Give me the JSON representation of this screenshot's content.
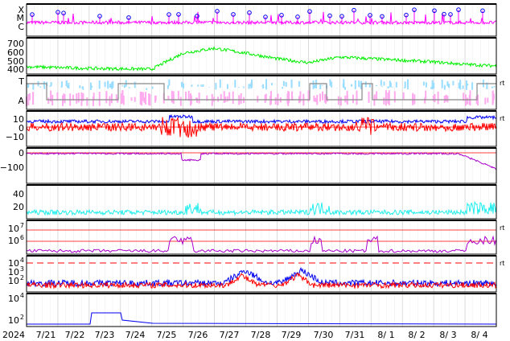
{
  "colors": {
    "magenta": "#ff00ff",
    "green": "#00ee00",
    "lightblue": "#99ddff",
    "pink": "#ffaaee",
    "gray": "#888888",
    "blue": "#0000ee",
    "red": "#ff0000",
    "purple": "#aa00cc",
    "cyan": "#22eeee",
    "frame": "#000000",
    "grid": "#cccccc"
  },
  "chart_data": {
    "type": "line",
    "x_tick_labels": [
      "2024",
      "7/21",
      "7/22",
      "7/23",
      "7/24",
      "7/25",
      "7/26",
      "7/27",
      "7/28",
      "7/29",
      "7/30",
      "7/31",
      "8/ 1",
      "8/ 2",
      "8/ 3",
      "8/ 4"
    ],
    "x_range_days": [
      "2024-07-20",
      "2024-08-04"
    ],
    "grid": true,
    "panels": [
      {
        "id": "flare-class",
        "type": "line",
        "y_tick_labels": [
          "X",
          "M",
          "C"
        ],
        "series": [
          {
            "color": "magenta",
            "markers": "circle",
            "marker_color": "#4444ff"
          }
        ]
      },
      {
        "id": "solar-wind-speed",
        "type": "line",
        "y_tick_labels": [
          "700",
          "600",
          "500",
          "400"
        ],
        "ylim": [
          300,
          750
        ],
        "series": [
          {
            "color": "green",
            "x": [
              "07-20",
              "07-22",
              "07-24",
              "07-25",
              "07-26",
              "07-27",
              "07-28",
              "07-29",
              "07-30",
              "07-31",
              "08-01",
              "08-02",
              "08-03",
              "08-04"
            ],
            "y": [
              390,
              370,
              360,
              560,
              620,
              560,
              490,
              440,
              510,
              490,
              470,
              450,
              420,
              400
            ]
          }
        ]
      },
      {
        "id": "imf-sector",
        "type": "line",
        "y_tick_labels": [
          "T",
          "A"
        ],
        "right_label": "rt",
        "series": [
          {
            "color": "gray"
          },
          {
            "color": "lightblue"
          },
          {
            "color": "pink"
          }
        ]
      },
      {
        "id": "imf-components",
        "type": "line",
        "y_tick_labels": [
          "10",
          "0",
          "−10"
        ],
        "ylim": [
          -15,
          15
        ],
        "right_label": "rt",
        "series": [
          {
            "color": "blue"
          },
          {
            "color": "red"
          }
        ]
      },
      {
        "id": "dst-index",
        "type": "line",
        "y_tick_labels": [
          "0",
          "−100"
        ],
        "ylim": [
          -130,
          20
        ],
        "series": [
          {
            "color": "purple",
            "x": [
              "07-20",
              "07-23",
              "07-25",
              "07-27",
              "07-29",
              "07-31",
              "08-02",
              "08-03",
              "08-04"
            ],
            "y": [
              -5,
              -10,
              -20,
              -15,
              -20,
              -15,
              -20,
              -40,
              -100
            ]
          }
        ]
      },
      {
        "id": "ae-index",
        "type": "line",
        "y_tick_labels": [
          "40",
          "20"
        ],
        "ylim": [
          0,
          50
        ],
        "series": [
          {
            "color": "cyan"
          }
        ]
      },
      {
        "id": "electron-flux",
        "type": "line",
        "y_tick_labels": [
          "10",
          "10"
        ],
        "y_tick_exponents": [
          "7",
          "6"
        ],
        "scale": "log",
        "right_label": "rt",
        "series": [
          {
            "color": "purple"
          }
        ]
      },
      {
        "id": "proton-flux",
        "type": "area",
        "y_tick_labels": [
          "10",
          "10",
          "10"
        ],
        "y_tick_exponents": [
          "4",
          "3",
          "2"
        ],
        "scale": "log",
        "right_label": "rt",
        "series": [
          {
            "color": "blue"
          },
          {
            "color": "red"
          }
        ]
      },
      {
        "id": "high-energy-proton",
        "type": "line",
        "y_tick_labels": [
          "10",
          "10"
        ],
        "y_tick_exponents": [
          "4",
          "2"
        ],
        "scale": "log",
        "series": [
          {
            "color": "blue",
            "x": [
              "07-20",
              "07-22",
              "07-22",
              "07-23",
              "07-23",
              "08-04"
            ],
            "y": [
              1,
              1,
              40,
              40,
              1,
              1
            ]
          }
        ]
      }
    ]
  }
}
